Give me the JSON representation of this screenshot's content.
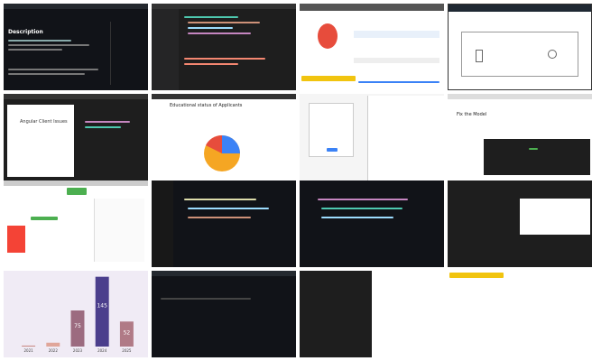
{
  "tiles": {
    "t1": {
      "heading": "Description"
    },
    "t5": {
      "title": "Angular Client Issues"
    },
    "t6": {
      "title": "Educational status of Applicants"
    },
    "t8": {
      "title": "Fix the Model"
    },
    "t13": {
      "chart_data": {
        "type": "bar",
        "categories": [
          "2021",
          "2022",
          "2023",
          "2024",
          "2025"
        ],
        "values": [
          2,
          8,
          75,
          145,
          52
        ],
        "colors": [
          "#c98b86",
          "#e0a69a",
          "#9c6b80",
          "#4b3e8c",
          "#b07a86"
        ],
        "ylim": [
          0,
          150
        ],
        "data_labels": [
          "",
          "",
          "75",
          "145",
          "52"
        ]
      }
    }
  }
}
